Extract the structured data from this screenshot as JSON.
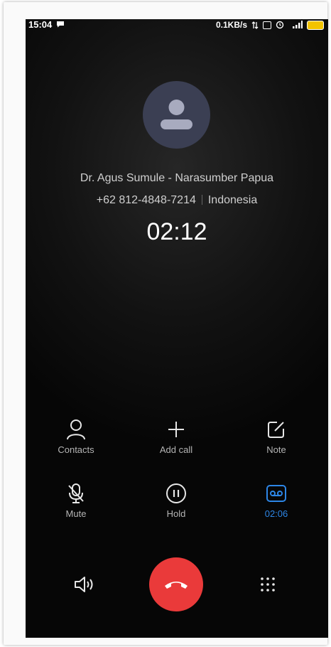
{
  "status_bar": {
    "time": "15:04",
    "net_speed": "0.1KB/s"
  },
  "caller": {
    "name": "Dr. Agus Sumule - Narasumber Papua",
    "number": "+62 812-4848-7214",
    "region": "Indonesia",
    "duration": "02:12"
  },
  "actions": {
    "contacts": "Contacts",
    "add_call": "Add call",
    "note": "Note",
    "mute": "Mute",
    "hold": "Hold",
    "recording": "02:06"
  },
  "colors": {
    "accent_blue": "#2d86e6",
    "end_call_red": "#ea3a3a",
    "avatar_bg": "#3b3f53",
    "battery": "#f3c300"
  },
  "icons": [
    "person-icon",
    "plus-icon",
    "note-icon",
    "mic-off-icon",
    "pause-icon",
    "voicemail-icon",
    "speaker-icon",
    "end-call-icon",
    "dialpad-icon"
  ]
}
